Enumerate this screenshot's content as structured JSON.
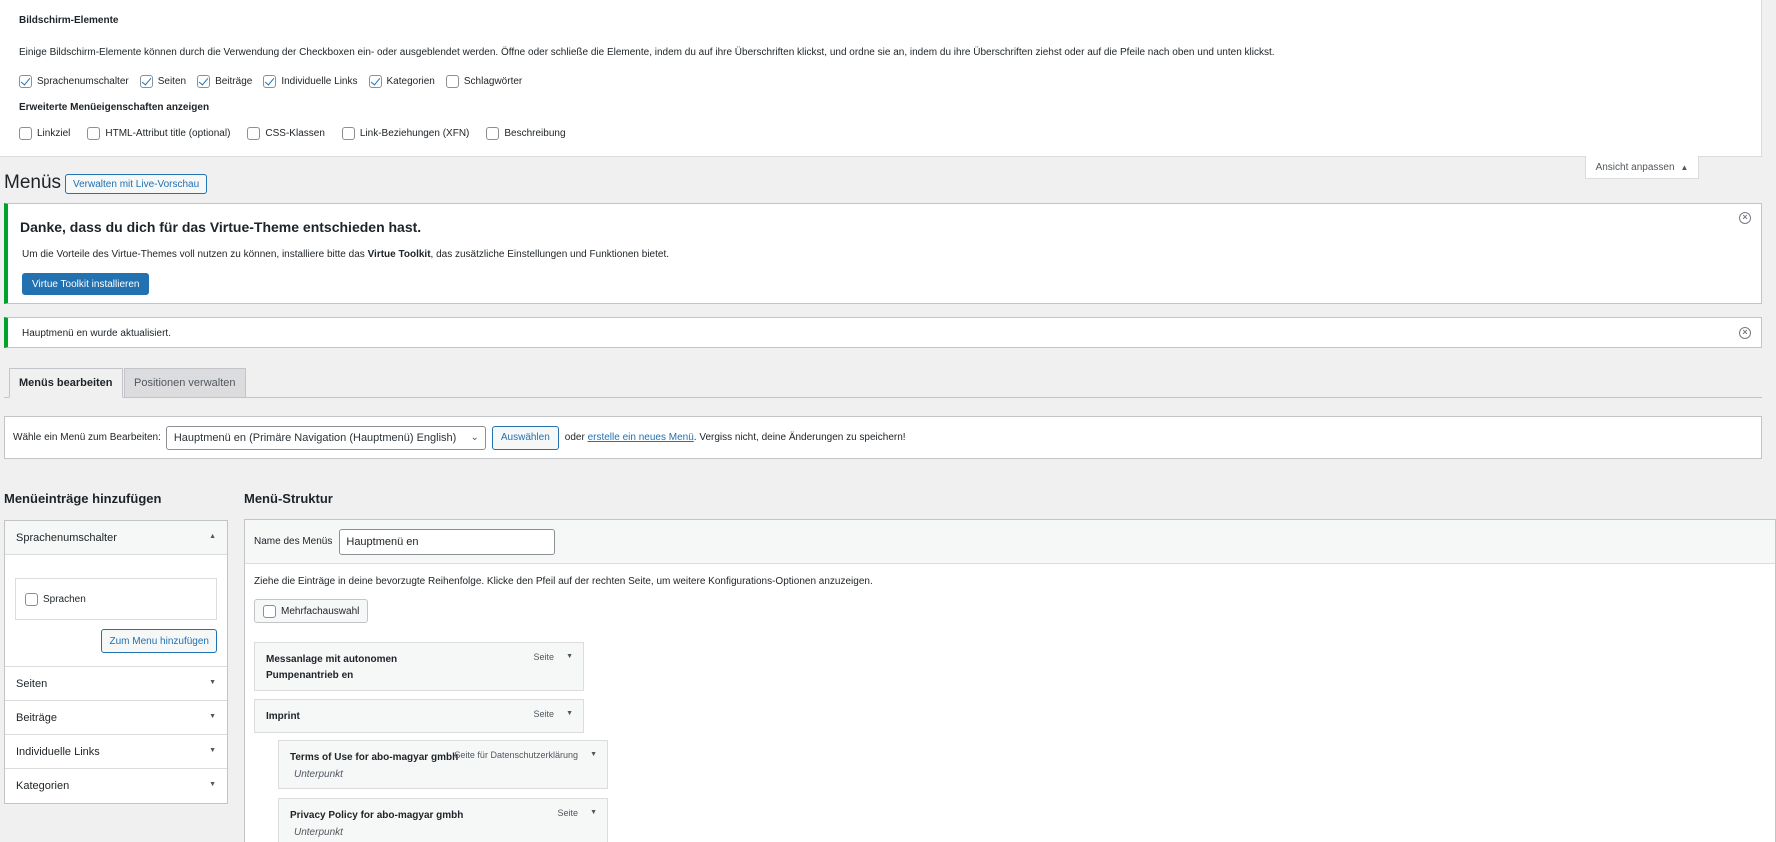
{
  "screen_options": {
    "title": "Bildschirm-Elemente",
    "description": "Einige Bildschirm-Elemente können durch die Verwendung der Checkboxen ein- oder ausgeblendet werden. Öffne oder schließe die Elemente, indem du auf ihre Überschriften klickst, und ordne sie an, indem du ihre Überschriften ziehst oder auf die Pfeile nach oben und unten klickst.",
    "boxes": [
      {
        "label": "Sprachenumschalter",
        "checked": true
      },
      {
        "label": "Seiten",
        "checked": true
      },
      {
        "label": "Beiträge",
        "checked": true
      },
      {
        "label": "Individuelle Links",
        "checked": true
      },
      {
        "label": "Kategorien",
        "checked": true
      },
      {
        "label": "Schlagwörter",
        "checked": false
      }
    ],
    "advanced_title": "Erweiterte Menüeigenschaften anzeigen",
    "advanced": [
      {
        "label": "Linkziel",
        "checked": false
      },
      {
        "label": "HTML-Attribut title (optional)",
        "checked": false
      },
      {
        "label": "CSS-Klassen",
        "checked": false
      },
      {
        "label": "Link-Beziehungen (XFN)",
        "checked": false
      },
      {
        "label": "Beschreibung",
        "checked": false
      }
    ],
    "tab_label": "Ansicht anpassen"
  },
  "header": {
    "title": "Menüs",
    "live_preview": "Verwalten mit Live-Vorschau"
  },
  "notice_theme": {
    "heading": "Danke, dass du dich für das Virtue-Theme entschieden hast.",
    "text_before": "Um die Vorteile des Virtue-Themes voll nutzen zu können, installiere bitte das ",
    "text_bold": "Virtue Toolkit",
    "text_after": ", das zusätzliche Einstellungen und Funktionen bietet.",
    "button": "Virtue Toolkit installieren"
  },
  "notice_updated": {
    "text": "Hauptmenü en wurde aktualisiert."
  },
  "tabs": {
    "edit": "Menüs bearbeiten",
    "locations": "Positionen verwalten"
  },
  "manage": {
    "label": "Wähle ein Menü zum Bearbeiten:",
    "selected": "Hauptmenü en (Primäre Navigation (Hauptmenü) English)",
    "select_button": "Auswählen",
    "or": "oder",
    "create_link": "erstelle ein neues Menü",
    "reminder": ". Vergiss nicht, deine Änderungen zu speichern!"
  },
  "add_items": {
    "title": "Menüeinträge hinzufügen",
    "panels": [
      {
        "label": "Sprachenumschalter"
      },
      {
        "label": "Seiten"
      },
      {
        "label": "Beiträge"
      },
      {
        "label": "Individuelle Links"
      },
      {
        "label": "Kategorien"
      }
    ],
    "open_panel": {
      "option": "Sprachen",
      "add_button": "Zum Menu hinzufügen"
    }
  },
  "structure": {
    "title": "Menü-Struktur",
    "name_label": "Name des Menüs",
    "name_value": "Hauptmenü en",
    "instructions": "Ziehe die Einträge in deine bevorzugte Reihenfolge. Klicke den Pfeil auf der rechten Seite, um weitere Konfigurations-Optionen anzuzeigen.",
    "bulk": "Mehrfachauswahl",
    "items": [
      {
        "title_line1": "Messanlage mit autonomen",
        "title_line2": "Pumpenantrieb en",
        "type": "Seite"
      },
      {
        "title": "Imprint",
        "type": "Seite"
      },
      {
        "title": "Terms of Use for abo-magyar gmbh",
        "type": "Seite für Datenschutzerklärung",
        "sub": "Unterpunkt"
      },
      {
        "title": "Privacy Policy for abo-magyar gmbh",
        "type": "Seite",
        "sub": "Unterpunkt"
      }
    ]
  }
}
